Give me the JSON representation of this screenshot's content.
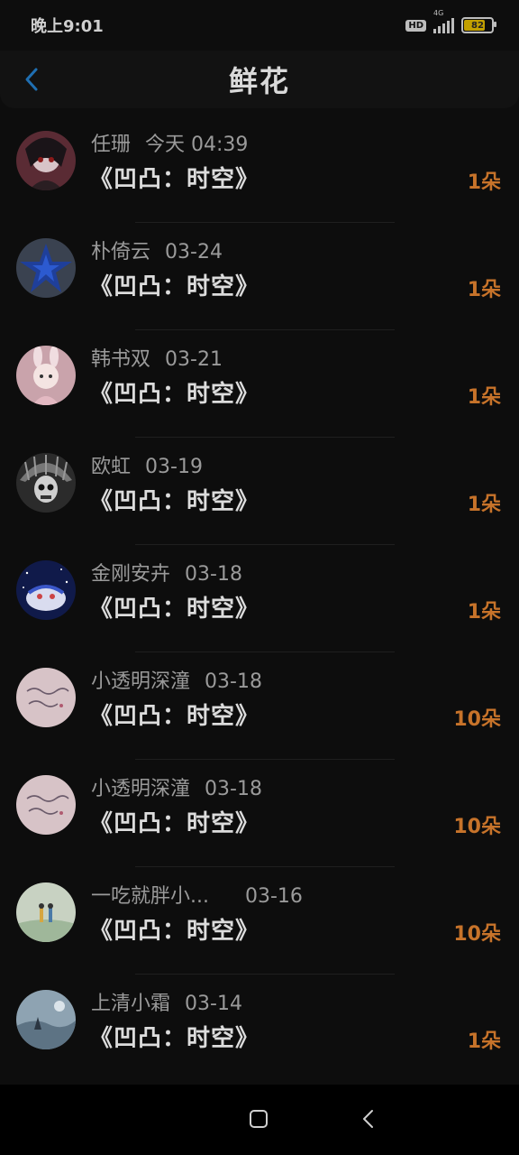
{
  "status_bar": {
    "time": "晚上9:01",
    "hd": "HD",
    "network": "4G",
    "battery": "82",
    "battery_level": 0.82
  },
  "header": {
    "title": "鲜花",
    "back_icon": "chevron-left-icon"
  },
  "items": [
    {
      "name": "任珊",
      "date": "今天 04:39",
      "title": "《凹凸：时空》",
      "count": "1朵"
    },
    {
      "name": "朴倚云",
      "date": "03-24",
      "title": "《凹凸：时空》",
      "count": "1朵"
    },
    {
      "name": "韩书双",
      "date": "03-21",
      "title": "《凹凸：时空》",
      "count": "1朵"
    },
    {
      "name": "欧虹",
      "date": "03-19",
      "title": "《凹凸：时空》",
      "count": "1朵"
    },
    {
      "name": "金刚安卉",
      "date": "03-18",
      "title": "《凹凸：时空》",
      "count": "1朵"
    },
    {
      "name": "小透明深潼",
      "date": "03-18",
      "title": "《凹凸：时空》",
      "count": "10朵"
    },
    {
      "name": "小透明深潼",
      "date": "03-18",
      "title": "《凹凸：时空》",
      "count": "10朵"
    },
    {
      "name": "一吃就胖小...",
      "date": "03-16",
      "title": "《凹凸：时空》",
      "count": "10朵"
    },
    {
      "name": "上清小霜",
      "date": "03-14",
      "title": "《凹凸：时空》",
      "count": "1朵"
    }
  ],
  "nav_bar": {
    "recents_icon": "square-icon",
    "back_icon": "back-triangle-icon"
  },
  "colors": {
    "accent_count": "#c7732a",
    "back_arrow": "#1f6fb2",
    "background": "#0d0d0d"
  }
}
